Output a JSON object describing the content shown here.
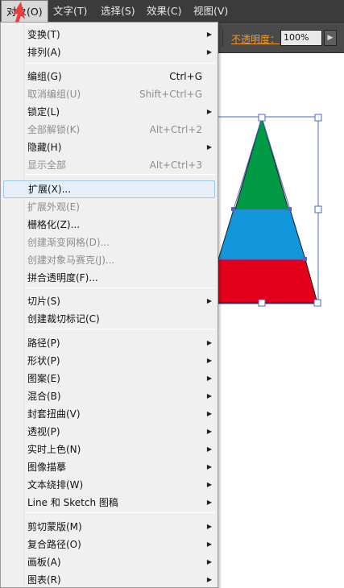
{
  "menubar": {
    "items": [
      {
        "label": "对象(O)",
        "active": true
      },
      {
        "label": "文字(T)"
      },
      {
        "label": "选择(S)"
      },
      {
        "label": "效果(C)"
      },
      {
        "label": "视图(V)"
      }
    ]
  },
  "control_bar": {
    "opacity_label": "不透明度：",
    "opacity_value": "100%",
    "expand_icon": "triangle-right-icon"
  },
  "menu": {
    "items": [
      {
        "label": "变换(T)",
        "submenu": true
      },
      {
        "label": "排列(A)",
        "submenu": true
      },
      {
        "label": "编组(G)",
        "shortcut": "Ctrl+G"
      },
      {
        "label": "取消编组(U)",
        "shortcut": "Shift+Ctrl+G",
        "disabled": true
      },
      {
        "label": "锁定(L)",
        "submenu": true
      },
      {
        "label": "全部解锁(K)",
        "shortcut": "Alt+Ctrl+2",
        "disabled": true
      },
      {
        "label": "隐藏(H)",
        "submenu": true
      },
      {
        "label": "显示全部",
        "shortcut": "Alt+Ctrl+3",
        "disabled": true
      },
      {
        "label": "扩展(X)...",
        "highlighted": true
      },
      {
        "label": "扩展外观(E)",
        "disabled": true
      },
      {
        "label": "栅格化(Z)..."
      },
      {
        "label": "创建渐变网格(D)...",
        "disabled": true
      },
      {
        "label": "创建对象马赛克(J)...",
        "disabled": true
      },
      {
        "label": "拼合透明度(F)..."
      },
      {
        "label": "切片(S)",
        "submenu": true
      },
      {
        "label": "创建裁切标记(C)"
      },
      {
        "label": "路径(P)",
        "submenu": true
      },
      {
        "label": "形状(P)",
        "submenu": true
      },
      {
        "label": "图案(E)",
        "submenu": true
      },
      {
        "label": "混合(B)",
        "submenu": true
      },
      {
        "label": "封套扭曲(V)",
        "submenu": true
      },
      {
        "label": "透视(P)",
        "submenu": true
      },
      {
        "label": "实时上色(N)",
        "submenu": true
      },
      {
        "label": "图像描摹",
        "submenu": true
      },
      {
        "label": "文本绕排(W)",
        "submenu": true
      },
      {
        "label": "Line 和 Sketch 图稿",
        "submenu": true
      },
      {
        "label": "剪切蒙版(M)",
        "submenu": true
      },
      {
        "label": "复合路径(O)",
        "submenu": true
      },
      {
        "label": "画板(A)",
        "submenu": true
      },
      {
        "label": "图表(R)",
        "submenu": true
      }
    ]
  },
  "artwork": {
    "colors": {
      "top": "#009a44",
      "middle": "#1296dc",
      "bottom": "#e2001a",
      "selection": "#4d64c8"
    }
  },
  "annotation": {
    "color": "#ee3b3b"
  }
}
